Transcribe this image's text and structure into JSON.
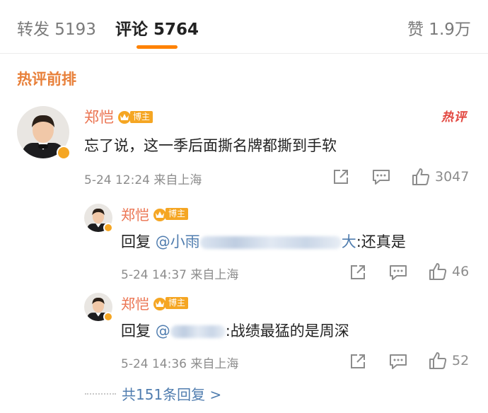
{
  "tabs": {
    "repost": "转发 5193",
    "comment": "评论 5764",
    "like": "赞 1.9万"
  },
  "section_title": "热评前排",
  "main_comment": {
    "author": "郑恺",
    "tag": "博主",
    "hot_label": "热评",
    "text": "忘了说，这一季后面撕名牌都撕到手软",
    "meta": "5-24 12:24 来自上海",
    "like_count": "3047"
  },
  "replies": [
    {
      "author": "郑恺",
      "tag": "博主",
      "prefix": "回复 ",
      "mention_start": "@小雨",
      "mention_end": "大",
      "text": ":还真是",
      "meta": "5-24 14:37 来自上海",
      "like_count": "46"
    },
    {
      "author": "郑恺",
      "tag": "博主",
      "prefix": "回复 ",
      "mention_start": "@",
      "mention_end": "",
      "text": ":战绩最猛的是周深",
      "meta": "5-24 14:36 来自上海",
      "like_count": "52"
    }
  ],
  "more_replies": "共151条回复 >",
  "colors": {
    "accent": "#ff8200",
    "author": "#eb7350",
    "link": "#507daf",
    "hot": "#e2463f",
    "section": "#e8803a"
  },
  "icons": [
    "share-icon",
    "comment-icon",
    "like-icon",
    "crown-icon",
    "verified-icon"
  ]
}
